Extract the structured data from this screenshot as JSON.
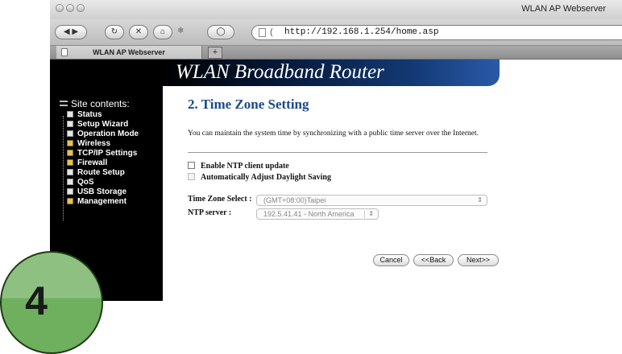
{
  "browser": {
    "window_title": "WLAN AP Webserver",
    "url": "http://192.168.1.254/home.asp",
    "tab_title": "WLAN AP Webserver",
    "new_tab_label": "+"
  },
  "page": {
    "banner_title": "WLAN Broadband Router",
    "section_title": "2. Time Zone Setting",
    "description": "You can maintain the system time by synchronizing with a public time server over the Internet."
  },
  "sidebar": {
    "header": "Site contents:",
    "items": [
      {
        "label": "Status",
        "icon": "document-icon"
      },
      {
        "label": "Setup Wizard",
        "icon": "document-icon"
      },
      {
        "label": "Operation Mode",
        "icon": "document-icon"
      },
      {
        "label": "Wireless",
        "icon": "folder-icon"
      },
      {
        "label": "TCP/IP Settings",
        "icon": "folder-icon"
      },
      {
        "label": "Firewall",
        "icon": "folder-icon"
      },
      {
        "label": "Route Setup",
        "icon": "document-icon"
      },
      {
        "label": "QoS",
        "icon": "document-icon"
      },
      {
        "label": "USB Storage",
        "icon": "document-icon"
      },
      {
        "label": "Management",
        "icon": "folder-icon"
      }
    ]
  },
  "form": {
    "enable_ntp_label": "Enable NTP client update",
    "enable_ntp_checked": false,
    "daylight_label": "Automatically Adjust Daylight Saving",
    "daylight_checked": false,
    "timezone_label": "Time Zone Select :",
    "timezone_value": "(GMT+08:00)Taipei",
    "ntp_server_label": "NTP server :",
    "ntp_server_value": "192.5.41.41 - North America"
  },
  "buttons": {
    "cancel": "Cancel",
    "back": "<<Back",
    "next": "Next>>"
  },
  "step_badge": {
    "number": "4"
  },
  "colors": {
    "banner_blue": "#133a75",
    "section_title": "#1b4a86",
    "badge_green": "#6eb05e"
  }
}
